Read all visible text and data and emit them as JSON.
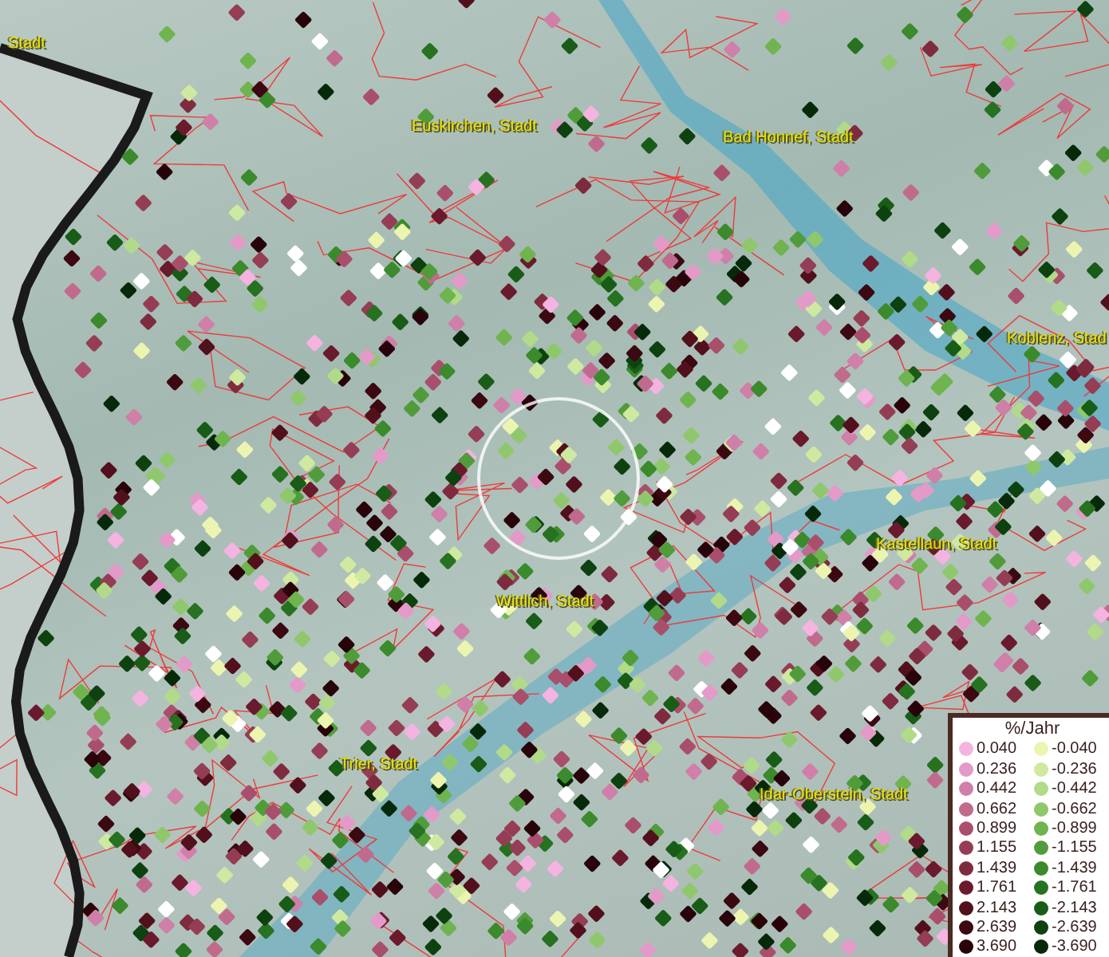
{
  "map": {
    "places": [
      {
        "name": "Stadt"
      },
      {
        "name": "Euskirchen, Stadt"
      },
      {
        "name": "Bad Honnef, Stadt"
      },
      {
        "name": "Koblenz, Stad"
      },
      {
        "name": "Kastellaun, Stadt"
      },
      {
        "name": "Wittlich, Stadt"
      },
      {
        "name": "Trier, Stadt"
      },
      {
        "name": "Idar-Oberstein, Stadt"
      }
    ]
  },
  "legend": {
    "title": "%/Jahr",
    "positive": [
      {
        "value": "0.040",
        "color": "#f4b3e0"
      },
      {
        "value": "0.236",
        "color": "#e39ac8"
      },
      {
        "value": "0.442",
        "color": "#cf7fa8"
      },
      {
        "value": "0.662",
        "color": "#c06b8e"
      },
      {
        "value": "0.899",
        "color": "#a94f6c"
      },
      {
        "value": "1.155",
        "color": "#953d55"
      },
      {
        "value": "1.439",
        "color": "#7f2b3f"
      },
      {
        "value": "1.761",
        "color": "#6a1a2c"
      },
      {
        "value": "2.143",
        "color": "#52101c"
      },
      {
        "value": "2.639",
        "color": "#3c0812"
      },
      {
        "value": "3.690",
        "color": "#28040a"
      }
    ],
    "negative": [
      {
        "value": "-0.040",
        "color": "#ecf5b0"
      },
      {
        "value": "-0.236",
        "color": "#cfe9a0"
      },
      {
        "value": "-0.442",
        "color": "#b1db88"
      },
      {
        "value": "-0.662",
        "color": "#8fc86c"
      },
      {
        "value": "-0.899",
        "color": "#6fb44f"
      },
      {
        "value": "-1.155",
        "color": "#519c3a"
      },
      {
        "value": "-1.439",
        "color": "#3b8a2c"
      },
      {
        "value": "-1.761",
        "color": "#267220"
      },
      {
        "value": "-2.143",
        "color": "#185c17"
      },
      {
        "value": "-2.639",
        "color": "#0d4210"
      },
      {
        "value": "-3.690",
        "color": "#062a09"
      }
    ]
  }
}
